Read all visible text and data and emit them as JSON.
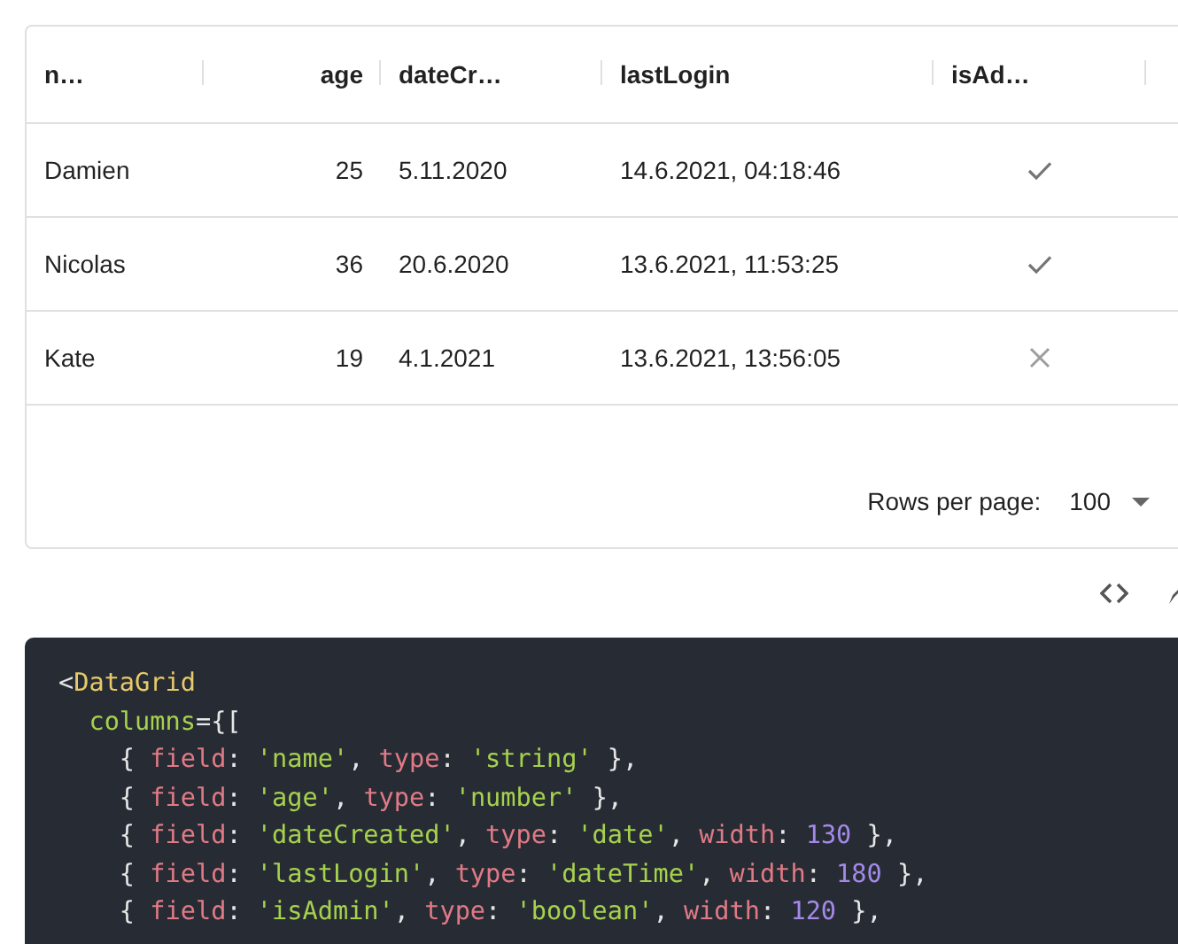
{
  "grid": {
    "columns": [
      {
        "label": "n…",
        "kind": "text"
      },
      {
        "label": "age",
        "kind": "number"
      },
      {
        "label": "dateCr…",
        "kind": "text"
      },
      {
        "label": "lastLogin",
        "kind": "text"
      },
      {
        "label": "isAd…",
        "kind": "boolean"
      }
    ],
    "rows": [
      {
        "cells": [
          "Damien",
          "25",
          "5.11.2020",
          "14.6.2021, 04:18:46"
        ],
        "isAdmin": true
      },
      {
        "cells": [
          "Nicolas",
          "36",
          "20.6.2020",
          "13.6.2021, 11:53:25"
        ],
        "isAdmin": true
      },
      {
        "cells": [
          "Kate",
          "19",
          "4.1.2021",
          "13.6.2021, 13:56:05"
        ],
        "isAdmin": false
      }
    ],
    "footer": {
      "rows_per_page_label": "Rows per page:",
      "rows_per_page_value": "100"
    }
  },
  "code": {
    "lines": [
      [
        {
          "kind": "punct",
          "text": "<"
        },
        {
          "kind": "tag",
          "text": "DataGrid"
        }
      ],
      [
        {
          "kind": "attr",
          "text": "  columns"
        },
        {
          "kind": "punct",
          "text": "={["
        }
      ],
      [
        {
          "kind": "punct",
          "text": "    { "
        },
        {
          "kind": "key",
          "text": "field"
        },
        {
          "kind": "punct",
          "text": ": "
        },
        {
          "kind": "str",
          "text": "'name'"
        },
        {
          "kind": "punct",
          "text": ", "
        },
        {
          "kind": "key",
          "text": "type"
        },
        {
          "kind": "punct",
          "text": ": "
        },
        {
          "kind": "str",
          "text": "'string'"
        },
        {
          "kind": "punct",
          "text": " },"
        }
      ],
      [
        {
          "kind": "punct",
          "text": "    { "
        },
        {
          "kind": "key",
          "text": "field"
        },
        {
          "kind": "punct",
          "text": ": "
        },
        {
          "kind": "str",
          "text": "'age'"
        },
        {
          "kind": "punct",
          "text": ", "
        },
        {
          "kind": "key",
          "text": "type"
        },
        {
          "kind": "punct",
          "text": ": "
        },
        {
          "kind": "str",
          "text": "'number'"
        },
        {
          "kind": "punct",
          "text": " },"
        }
      ],
      [
        {
          "kind": "punct",
          "text": "    { "
        },
        {
          "kind": "key",
          "text": "field"
        },
        {
          "kind": "punct",
          "text": ": "
        },
        {
          "kind": "str",
          "text": "'dateCreated'"
        },
        {
          "kind": "punct",
          "text": ", "
        },
        {
          "kind": "key",
          "text": "type"
        },
        {
          "kind": "punct",
          "text": ": "
        },
        {
          "kind": "str",
          "text": "'date'"
        },
        {
          "kind": "punct",
          "text": ", "
        },
        {
          "kind": "key",
          "text": "width"
        },
        {
          "kind": "punct",
          "text": ": "
        },
        {
          "kind": "num",
          "text": "130"
        },
        {
          "kind": "punct",
          "text": " },"
        }
      ],
      [
        {
          "kind": "punct",
          "text": "    { "
        },
        {
          "kind": "key",
          "text": "field"
        },
        {
          "kind": "punct",
          "text": ": "
        },
        {
          "kind": "str",
          "text": "'lastLogin'"
        },
        {
          "kind": "punct",
          "text": ", "
        },
        {
          "kind": "key",
          "text": "type"
        },
        {
          "kind": "punct",
          "text": ": "
        },
        {
          "kind": "str",
          "text": "'dateTime'"
        },
        {
          "kind": "punct",
          "text": ", "
        },
        {
          "kind": "key",
          "text": "width"
        },
        {
          "kind": "punct",
          "text": ": "
        },
        {
          "kind": "num",
          "text": "180"
        },
        {
          "kind": "punct",
          "text": " },"
        }
      ],
      [
        {
          "kind": "punct",
          "text": "    { "
        },
        {
          "kind": "key",
          "text": "field"
        },
        {
          "kind": "punct",
          "text": ": "
        },
        {
          "kind": "str",
          "text": "'isAdmin'"
        },
        {
          "kind": "punct",
          "text": ", "
        },
        {
          "kind": "key",
          "text": "type"
        },
        {
          "kind": "punct",
          "text": ": "
        },
        {
          "kind": "str",
          "text": "'boolean'"
        },
        {
          "kind": "punct",
          "text": ", "
        },
        {
          "kind": "key",
          "text": "width"
        },
        {
          "kind": "punct",
          "text": ": "
        },
        {
          "kind": "num",
          "text": "120"
        },
        {
          "kind": "punct",
          "text": " },"
        }
      ]
    ]
  }
}
